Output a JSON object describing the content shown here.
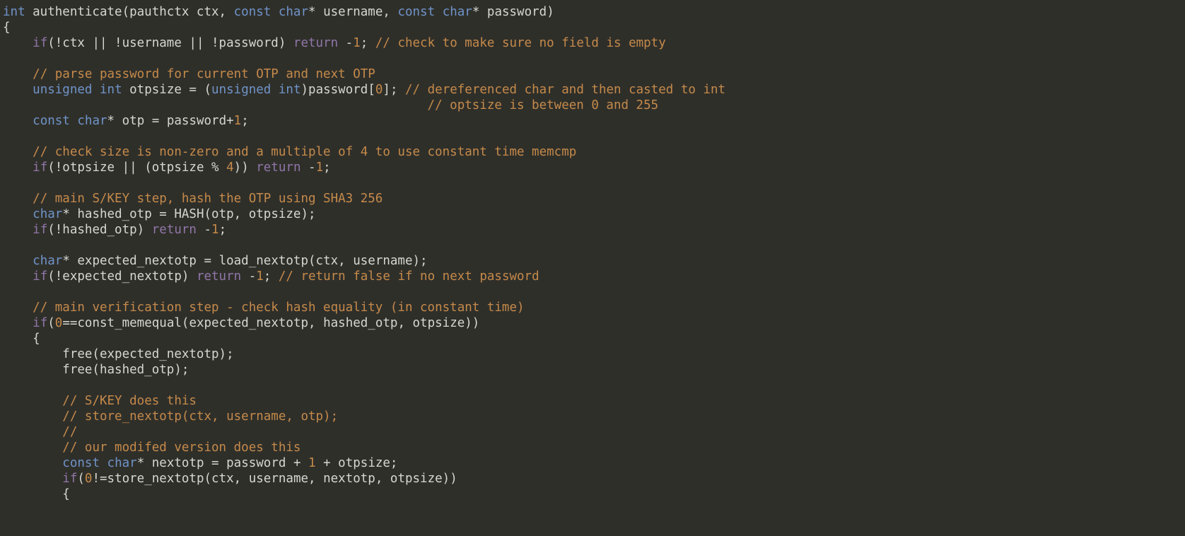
{
  "code": {
    "lines": [
      [
        {
          "cls": "tok-type",
          "t": "int"
        },
        {
          "cls": "tok-ident",
          "t": " authenticate(pauthctx ctx, "
        },
        {
          "cls": "tok-type",
          "t": "const"
        },
        {
          "cls": "tok-ident",
          "t": " "
        },
        {
          "cls": "tok-type",
          "t": "char"
        },
        {
          "cls": "tok-ident",
          "t": "* username, "
        },
        {
          "cls": "tok-type",
          "t": "const"
        },
        {
          "cls": "tok-ident",
          "t": " "
        },
        {
          "cls": "tok-type",
          "t": "char"
        },
        {
          "cls": "tok-ident",
          "t": "* password)"
        }
      ],
      [
        {
          "cls": "tok-punc",
          "t": "{"
        }
      ],
      [
        {
          "cls": "tok-ident",
          "t": "    "
        },
        {
          "cls": "tok-kw",
          "t": "if"
        },
        {
          "cls": "tok-ident",
          "t": "(!ctx || !username || !password) "
        },
        {
          "cls": "tok-kw",
          "t": "return"
        },
        {
          "cls": "tok-ident",
          "t": " -"
        },
        {
          "cls": "tok-num",
          "t": "1"
        },
        {
          "cls": "tok-ident",
          "t": "; "
        },
        {
          "cls": "tok-comment",
          "t": "// check to make sure no field is empty"
        }
      ],
      [
        {
          "cls": "tok-ident",
          "t": " "
        }
      ],
      [
        {
          "cls": "tok-ident",
          "t": "    "
        },
        {
          "cls": "tok-comment",
          "t": "// parse password for current OTP and next OTP"
        }
      ],
      [
        {
          "cls": "tok-ident",
          "t": "    "
        },
        {
          "cls": "tok-type",
          "t": "unsigned"
        },
        {
          "cls": "tok-ident",
          "t": " "
        },
        {
          "cls": "tok-type",
          "t": "int"
        },
        {
          "cls": "tok-ident",
          "t": " otpsize = ("
        },
        {
          "cls": "tok-type",
          "t": "unsigned"
        },
        {
          "cls": "tok-ident",
          "t": " "
        },
        {
          "cls": "tok-type",
          "t": "int"
        },
        {
          "cls": "tok-ident",
          "t": ")password["
        },
        {
          "cls": "tok-num",
          "t": "0"
        },
        {
          "cls": "tok-ident",
          "t": "]; "
        },
        {
          "cls": "tok-comment",
          "t": "// dereferenced char and then casted to int"
        }
      ],
      [
        {
          "cls": "tok-ident",
          "t": "                                                         "
        },
        {
          "cls": "tok-comment",
          "t": "// optsize is between 0 and 255"
        }
      ],
      [
        {
          "cls": "tok-ident",
          "t": "    "
        },
        {
          "cls": "tok-type",
          "t": "const"
        },
        {
          "cls": "tok-ident",
          "t": " "
        },
        {
          "cls": "tok-type",
          "t": "char"
        },
        {
          "cls": "tok-ident",
          "t": "* otp = password+"
        },
        {
          "cls": "tok-num",
          "t": "1"
        },
        {
          "cls": "tok-ident",
          "t": ";"
        }
      ],
      [
        {
          "cls": "tok-ident",
          "t": " "
        }
      ],
      [
        {
          "cls": "tok-ident",
          "t": "    "
        },
        {
          "cls": "tok-comment",
          "t": "// check size is non-zero and a multiple of 4 to use constant time memcmp"
        }
      ],
      [
        {
          "cls": "tok-ident",
          "t": "    "
        },
        {
          "cls": "tok-kw",
          "t": "if"
        },
        {
          "cls": "tok-ident",
          "t": "(!otpsize || (otpsize % "
        },
        {
          "cls": "tok-num",
          "t": "4"
        },
        {
          "cls": "tok-ident",
          "t": ")) "
        },
        {
          "cls": "tok-kw",
          "t": "return"
        },
        {
          "cls": "tok-ident",
          "t": " -"
        },
        {
          "cls": "tok-num",
          "t": "1"
        },
        {
          "cls": "tok-ident",
          "t": ";"
        }
      ],
      [
        {
          "cls": "tok-ident",
          "t": " "
        }
      ],
      [
        {
          "cls": "tok-ident",
          "t": "    "
        },
        {
          "cls": "tok-comment",
          "t": "// main S/KEY step, hash the OTP using SHA3 256"
        }
      ],
      [
        {
          "cls": "tok-ident",
          "t": "    "
        },
        {
          "cls": "tok-type",
          "t": "char"
        },
        {
          "cls": "tok-ident",
          "t": "* hashed_otp = HASH(otp, otpsize);"
        }
      ],
      [
        {
          "cls": "tok-ident",
          "t": "    "
        },
        {
          "cls": "tok-kw",
          "t": "if"
        },
        {
          "cls": "tok-ident",
          "t": "(!hashed_otp) "
        },
        {
          "cls": "tok-kw",
          "t": "return"
        },
        {
          "cls": "tok-ident",
          "t": " -"
        },
        {
          "cls": "tok-num",
          "t": "1"
        },
        {
          "cls": "tok-ident",
          "t": ";"
        }
      ],
      [
        {
          "cls": "tok-ident",
          "t": " "
        }
      ],
      [
        {
          "cls": "tok-ident",
          "t": "    "
        },
        {
          "cls": "tok-type",
          "t": "char"
        },
        {
          "cls": "tok-ident",
          "t": "* expected_nextotp = load_nextotp(ctx, username);"
        }
      ],
      [
        {
          "cls": "tok-ident",
          "t": "    "
        },
        {
          "cls": "tok-kw",
          "t": "if"
        },
        {
          "cls": "tok-ident",
          "t": "(!expected_nextotp) "
        },
        {
          "cls": "tok-kw",
          "t": "return"
        },
        {
          "cls": "tok-ident",
          "t": " -"
        },
        {
          "cls": "tok-num",
          "t": "1"
        },
        {
          "cls": "tok-ident",
          "t": "; "
        },
        {
          "cls": "tok-comment",
          "t": "// return false if no next password"
        }
      ],
      [
        {
          "cls": "tok-ident",
          "t": " "
        }
      ],
      [
        {
          "cls": "tok-ident",
          "t": "    "
        },
        {
          "cls": "tok-comment",
          "t": "// main verification step - check hash equality (in constant time)"
        }
      ],
      [
        {
          "cls": "tok-ident",
          "t": "    "
        },
        {
          "cls": "tok-kw",
          "t": "if"
        },
        {
          "cls": "tok-ident",
          "t": "("
        },
        {
          "cls": "tok-num",
          "t": "0"
        },
        {
          "cls": "tok-ident",
          "t": "==const_memequal(expected_nextotp, hashed_otp, otpsize))"
        }
      ],
      [
        {
          "cls": "tok-ident",
          "t": "    {"
        }
      ],
      [
        {
          "cls": "tok-ident",
          "t": "        free(expected_nextotp);"
        }
      ],
      [
        {
          "cls": "tok-ident",
          "t": "        free(hashed_otp);"
        }
      ],
      [
        {
          "cls": "tok-ident",
          "t": " "
        }
      ],
      [
        {
          "cls": "tok-ident",
          "t": "        "
        },
        {
          "cls": "tok-comment",
          "t": "// S/KEY does this"
        }
      ],
      [
        {
          "cls": "tok-ident",
          "t": "        "
        },
        {
          "cls": "tok-comment",
          "t": "// store_nextotp(ctx, username, otp);"
        }
      ],
      [
        {
          "cls": "tok-ident",
          "t": "        "
        },
        {
          "cls": "tok-comment",
          "t": "//"
        }
      ],
      [
        {
          "cls": "tok-ident",
          "t": "        "
        },
        {
          "cls": "tok-comment",
          "t": "// our modifed version does this"
        }
      ],
      [
        {
          "cls": "tok-ident",
          "t": "        "
        },
        {
          "cls": "tok-type",
          "t": "const"
        },
        {
          "cls": "tok-ident",
          "t": " "
        },
        {
          "cls": "tok-type",
          "t": "char"
        },
        {
          "cls": "tok-ident",
          "t": "* nextotp = password + "
        },
        {
          "cls": "tok-num",
          "t": "1"
        },
        {
          "cls": "tok-ident",
          "t": " + otpsize;"
        }
      ],
      [
        {
          "cls": "tok-ident",
          "t": "        "
        },
        {
          "cls": "tok-kw",
          "t": "if"
        },
        {
          "cls": "tok-ident",
          "t": "("
        },
        {
          "cls": "tok-num",
          "t": "0"
        },
        {
          "cls": "tok-ident",
          "t": "!=store_nextotp(ctx, username, nextotp, otpsize))"
        }
      ],
      [
        {
          "cls": "tok-ident",
          "t": "        {"
        }
      ]
    ]
  }
}
